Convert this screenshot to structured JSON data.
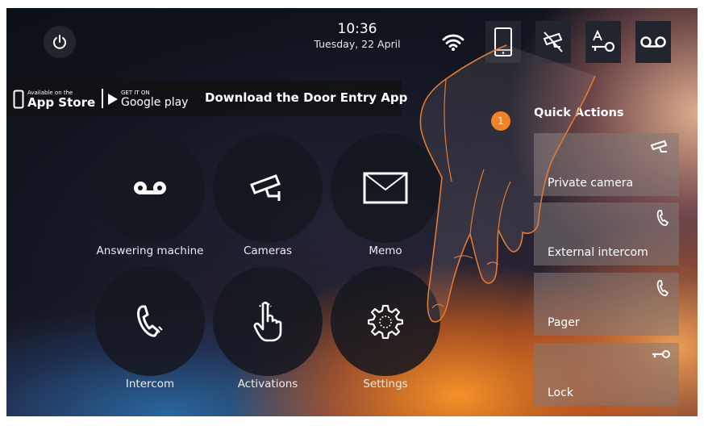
{
  "status_bar": {
    "time": "10:36",
    "date": "Tuesday, 22 April",
    "icons": [
      "power-icon",
      "wifi-icon",
      "smartphone-icon",
      "camera-off-icon",
      "key-icon",
      "answering-machine-icon"
    ]
  },
  "app_banner": {
    "apple_small": "Available on the",
    "apple_big": "App Store",
    "google_small": "GET IT ON",
    "google_big": "Google play",
    "text": "Download the Door Entry App"
  },
  "main_menu": [
    {
      "label": "Answering machine",
      "icon": "answering-machine-icon"
    },
    {
      "label": "Cameras",
      "icon": "camera-icon"
    },
    {
      "label": "Memo",
      "icon": "envelope-icon"
    },
    {
      "label": "Intercom",
      "icon": "phone-icon"
    },
    {
      "label": "Activations",
      "icon": "touch-hand-icon"
    },
    {
      "label": "Settings",
      "icon": "gear-icon"
    }
  ],
  "quick_actions": {
    "title": "Quick Actions",
    "items": [
      {
        "label": "Private camera",
        "icon": "camera-icon"
      },
      {
        "label": "External intercom",
        "icon": "phone-icon"
      },
      {
        "label": "Pager",
        "icon": "phone-icon"
      },
      {
        "label": "Lock",
        "icon": "key-icon"
      }
    ]
  },
  "callout": {
    "number": "1"
  },
  "colors": {
    "accent": "#f08228",
    "circle_bg": "#16181f",
    "tile_bg": "#827878"
  }
}
